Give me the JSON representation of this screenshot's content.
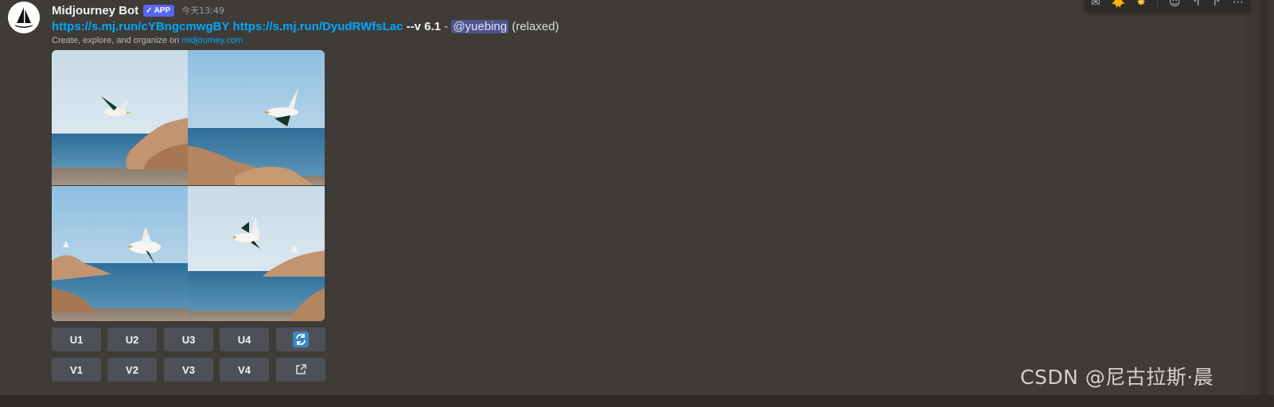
{
  "message": {
    "username": "Midjourney Bot",
    "badge": "APP",
    "timestamp": "今天13:49",
    "link1": "https://s.mj.run/cYBngcmwgBY",
    "link2": "https://s.mj.run/DyudRWfsLac",
    "version_flag": "--v 6.1",
    "dash": "-",
    "mention": "@yuebing",
    "mode": "(relaxed)",
    "subtext_prefix": "Create, explore, and organize on",
    "subtext_link": "midjourney.com"
  },
  "buttons": {
    "u1": "U1",
    "u2": "U2",
    "u3": "U3",
    "u4": "U4",
    "v1": "V1",
    "v2": "V2",
    "v3": "V3",
    "v4": "V4"
  },
  "watermark": "CSDN @尼古拉斯·晨",
  "colors": {
    "background": "#3f3b37",
    "link": "#00a8fc",
    "badge": "#5865f2",
    "button": "#4e5058",
    "mention_bg": "#4f5587"
  },
  "icons": {
    "refresh": "refresh-icon",
    "external": "external-link-icon"
  }
}
